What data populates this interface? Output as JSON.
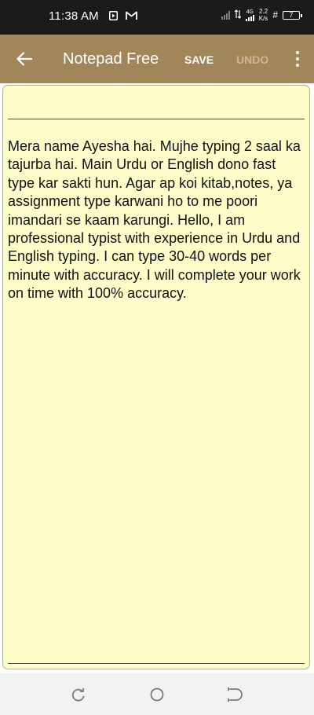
{
  "status_bar": {
    "time": "11:38 AM",
    "network_label": "4G",
    "speed_value": "2.2",
    "speed_unit": "K/s",
    "battery_level": "7"
  },
  "toolbar": {
    "title": "Notepad Free",
    "save_label": "SAVE",
    "undo_label": "UNDO"
  },
  "note": {
    "title_value": "",
    "body": "Mera name Ayesha hai. Mujhe typing 2 saal ka tajurba hai. Main Urdu or English dono fast type kar sakti hun. Agar ap koi kitab,notes, ya assignment type karwani ho to me poori imandari se kaam karungi. Hello, I am professional typist with experience in Urdu and English typing. I can type 30-40 words per minute with accuracy. I will complete your work on time with 100% accuracy."
  },
  "colors": {
    "toolbar": "#a18659",
    "paper": "#fefdca",
    "status_bar": "#1b1b1b",
    "undo_disabled": "#c9b897"
  },
  "icons": {
    "back": "arrow-left-icon",
    "more": "more-vertical-icon",
    "nav_recent": "recent-apps-icon",
    "nav_home": "home-icon",
    "nav_back": "back-nav-icon"
  }
}
